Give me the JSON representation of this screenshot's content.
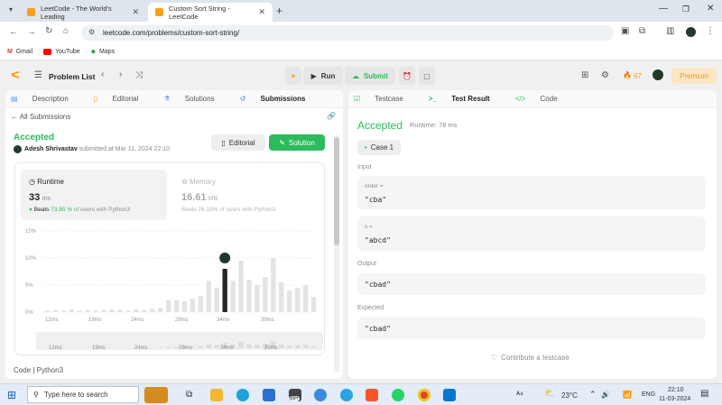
{
  "browser": {
    "tabs": [
      {
        "title": "LeetCode - The World's Leading"
      },
      {
        "title": "Custom Sort String - LeetCode"
      }
    ],
    "url": "leetcode.com/problems/custom-sort-string/",
    "bookmarks": [
      "Gmail",
      "YouTube",
      "Maps"
    ]
  },
  "nav": {
    "problem_list": "Problem List",
    "run": "Run",
    "submit": "Submit",
    "streak": "67",
    "premium": "Premium"
  },
  "left": {
    "tabs": [
      "Description",
      "Editorial",
      "Solutions",
      "Submissions"
    ],
    "all_submissions": "All Submissions",
    "status": "Accepted",
    "user": "Adesh Shrivastav",
    "submitted": "submitted at Mar 11, 2024 22:10",
    "editorial_btn": "Editorial",
    "solution_btn": "Solution",
    "runtime": {
      "label": "Runtime",
      "value": "33",
      "unit": "ms",
      "beats_pre": "Beats",
      "beats_pct": "73.85 %",
      "beats_post": "of users with Python3"
    },
    "memory": {
      "label": "Memory",
      "value": "16.61",
      "unit": "MB",
      "beats": "Beats 26.18% of users with Python3"
    },
    "code_label": "Code",
    "lang": "Python3"
  },
  "chart_data": {
    "type": "bar",
    "ylabels": [
      "15%",
      "10%",
      "5%",
      "0%"
    ],
    "ylim": [
      0,
      15
    ],
    "xlabels": [
      "12ms",
      "19ms",
      "24ms",
      "29ms",
      "34ms",
      "39ms"
    ],
    "values": [
      0.3,
      0.4,
      0.3,
      0.5,
      0.3,
      0.4,
      0.3,
      0.4,
      0.5,
      0.4,
      0.3,
      0.5,
      0.4,
      0.6,
      0.8,
      2.2,
      2.2,
      2.0,
      2.5,
      3.0,
      5.8,
      4.5,
      8.0,
      5.8,
      9.5,
      6.0,
      5.0,
      6.5,
      10.0,
      5.5,
      4.0,
      4.5,
      5.0,
      2.8
    ],
    "highlight_index": 22,
    "mini_xlabels": [
      "12ms",
      "19ms",
      "24ms",
      "29ms",
      "34ms",
      "39ms"
    ]
  },
  "right": {
    "tabs": [
      "Testcase",
      "Test Result",
      "Code"
    ],
    "status": "Accepted",
    "runtime": "Runtime: 78 ms",
    "case": "Case 1",
    "input_label": "Input",
    "order_label": "order =",
    "order_val": "\"cba\"",
    "s_label": "s =",
    "s_val": "\"abcd\"",
    "output_label": "Output",
    "output_val": "\"cbad\"",
    "expected_label": "Expected",
    "expected_val": "\"cbad\"",
    "contribute": "Contribute a testcase"
  },
  "taskbar": {
    "search": "Type here to search",
    "temp": "23°C",
    "lang": "ENG",
    "time": "22:10",
    "date": "11-03-2024",
    "badge": "99+"
  }
}
